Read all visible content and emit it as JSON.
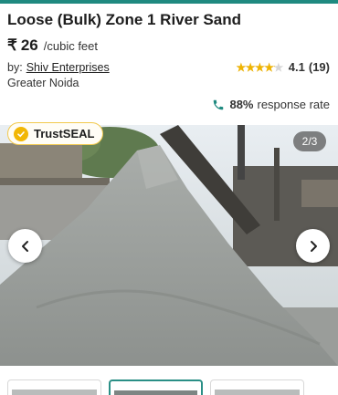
{
  "product": {
    "title": "Loose (Bulk) Zone 1 River Sand",
    "currency_symbol": "₹",
    "price": "26",
    "unit": "/cubic feet"
  },
  "seller": {
    "by_label": "by:",
    "name": "Shiv Enterprises",
    "location": "Greater Noida"
  },
  "rating": {
    "score": "4.1",
    "count": "(19)",
    "stars_filled_fraction": 0.82,
    "star_color": "#f0b400"
  },
  "response": {
    "percent": "88%",
    "label": "response rate",
    "icon": "phone-icon",
    "icon_color": "#1f8a80"
  },
  "gallery": {
    "trust_label": "TrustSEAL",
    "counter": "2/3",
    "prev_icon": "chevron-left-icon",
    "next_icon": "chevron-right-icon",
    "image_description_icon": "sand-pile-photo",
    "thumbnails": [
      "thumb-1",
      "thumb-2",
      "thumb-3"
    ],
    "active_thumbnail_index": 1
  },
  "colors": {
    "accent": "#1f8a80",
    "trust_badge": "#f2b705"
  }
}
